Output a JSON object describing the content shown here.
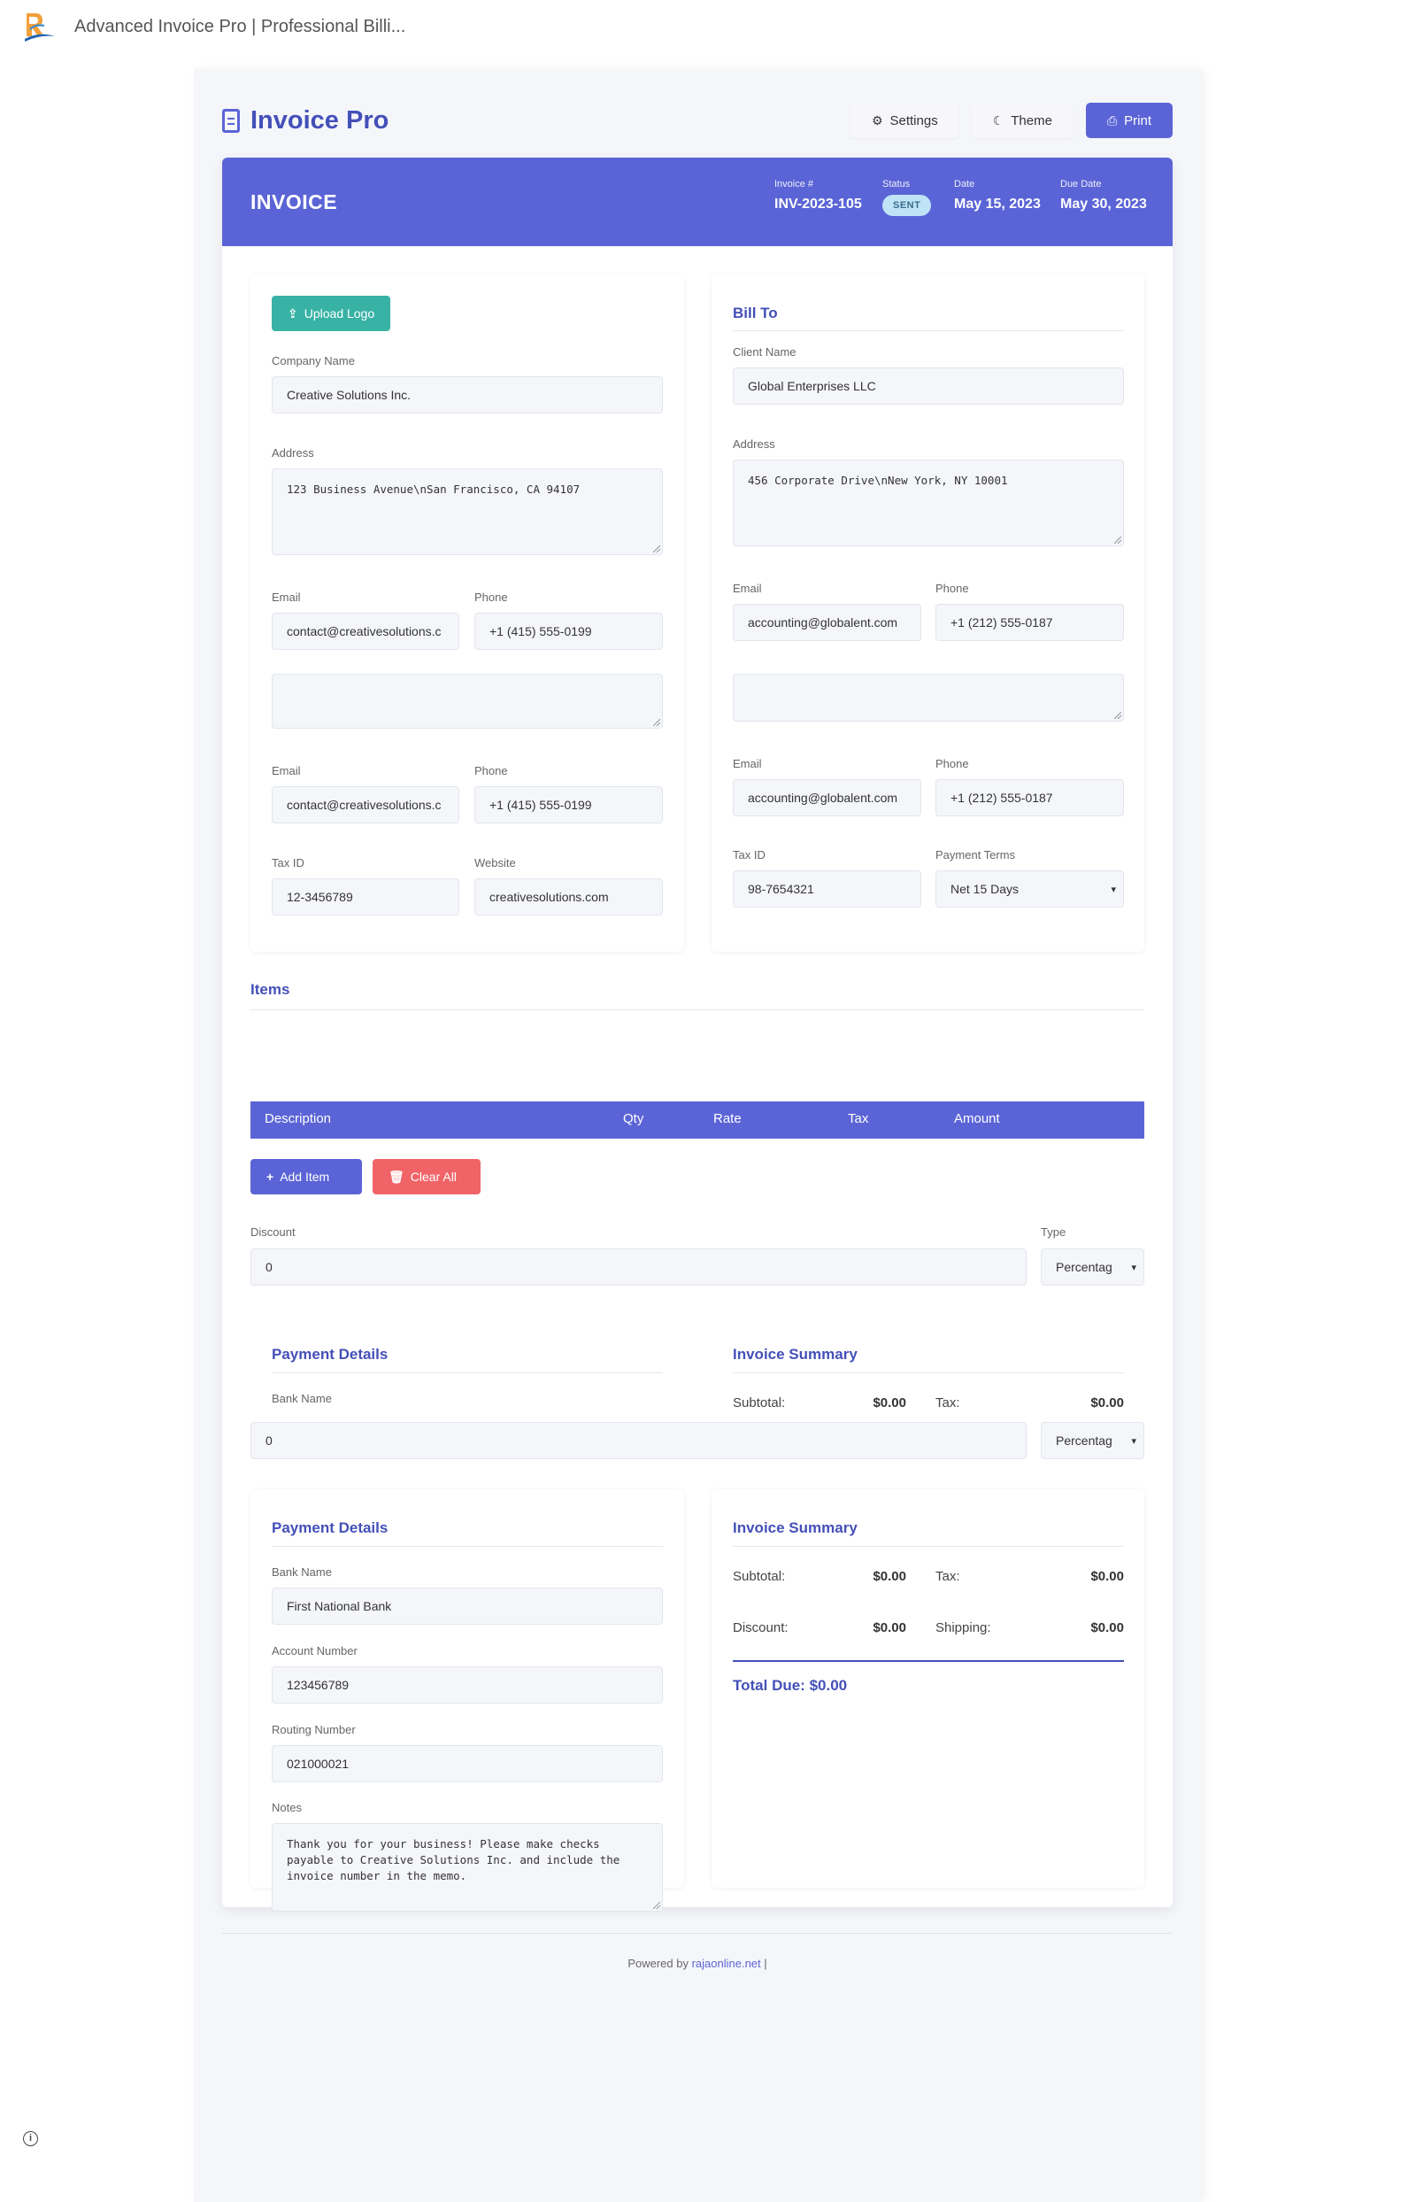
{
  "browser": {
    "tab_title": "Advanced Invoice Pro | Professional Billi..."
  },
  "header": {
    "brand": "Invoice Pro",
    "settings_label": "Settings",
    "theme_label": "Theme",
    "print_label": "Print"
  },
  "banner": {
    "title": "INVOICE",
    "invoice_no_label": "Invoice #",
    "invoice_no": "INV-2023-105",
    "status_label": "Status",
    "status": "SENT",
    "date_label": "Date",
    "date": "May 15, 2023",
    "due_label": "Due Date",
    "due_date": "May 30, 2023"
  },
  "from": {
    "upload_logo": "Upload Logo",
    "company_label": "Company Name",
    "company": "Creative Solutions Inc.",
    "address_label": "Address",
    "address": "123 Business Avenue\\nSan Francisco, CA 94107",
    "email_label": "Email",
    "email": "contact@creativesolutions.c",
    "phone_label": "Phone",
    "phone": "+1 (415) 555-0199",
    "email_label_2": "Email",
    "email_2": "contact@creativesolutions.c",
    "phone_label_2": "Phone",
    "phone_2": "+1 (415) 555-0199",
    "taxid_label": "Tax ID",
    "taxid": "12-3456789",
    "website_label": "Website",
    "website": "creativesolutions.com"
  },
  "bill_to": {
    "title": "Bill To",
    "client_label": "Client Name",
    "client": "Global Enterprises LLC",
    "address_label": "Address",
    "address": "456 Corporate Drive\\nNew York, NY 10001",
    "email_label": "Email",
    "email": "accounting@globalent.com",
    "phone_label": "Phone",
    "phone": "+1 (212) 555-0187",
    "email_label_2": "Email",
    "email_2": "accounting@globalent.com",
    "phone_label_2": "Phone",
    "phone_2": "+1 (212) 555-0187",
    "taxid_label": "Tax ID",
    "taxid": "98-7654321",
    "terms_label": "Payment Terms",
    "terms": "Net 15 Days"
  },
  "items": {
    "title": "Items",
    "columns": [
      "Description",
      "Qty",
      "Rate",
      "Tax",
      "Amount"
    ],
    "add_item": "Add Item",
    "clear_all": "Clear All",
    "discount_label": "Discount",
    "discount": "0",
    "type_label": "Type",
    "type": "Percentag",
    "discount_2": "0",
    "type_2": "Percentag"
  },
  "payment_ghost": {
    "title": "Payment Details",
    "bank_label": "Bank Name"
  },
  "summary_ghost": {
    "title": "Invoice Summary",
    "subtotal_label": "Subtotal:",
    "subtotal": "$0.00",
    "tax_label": "Tax:",
    "tax": "$0.00"
  },
  "payment": {
    "title": "Payment Details",
    "bank_label": "Bank Name",
    "bank": "First National Bank",
    "account_label": "Account Number",
    "account": "123456789",
    "routing_label": "Routing Number",
    "routing": "021000021",
    "notes_label": "Notes",
    "notes": "Thank you for your business! Please make checks payable to Creative Solutions Inc. and include the invoice number in the memo."
  },
  "summary": {
    "title": "Invoice Summary",
    "subtotal_label": "Subtotal:",
    "subtotal": "$0.00",
    "tax_label": "Tax:",
    "tax": "$0.00",
    "discount_label": "Discount:",
    "discount": "$0.00",
    "shipping_label": "Shipping:",
    "shipping": "$0.00",
    "total": "Total Due: $0.00"
  },
  "footer": {
    "powered_by": "Powered by",
    "link": "rajaonline.net",
    "sep": "|"
  },
  "colors": {
    "primary": "#5b64d6",
    "brand_text": "#4450b8",
    "teal": "#38b2a5",
    "red": "#f06468",
    "badge": "#bfe3f7"
  }
}
